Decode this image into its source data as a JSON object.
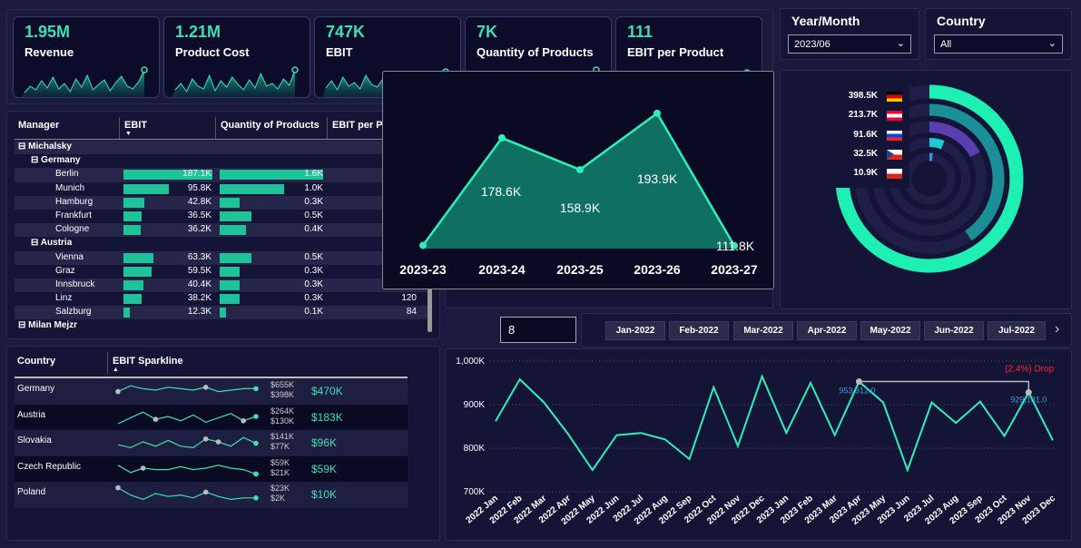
{
  "kpis": [
    {
      "value": "1.95M",
      "label": "Revenue"
    },
    {
      "value": "1.21M",
      "label": "Product Cost"
    },
    {
      "value": "747K",
      "label": "EBIT"
    },
    {
      "value": "7K",
      "label": "Quantity of Products"
    },
    {
      "value": "111",
      "label": "EBIT per Product"
    }
  ],
  "filters": {
    "year_month": {
      "title": "Year/Month",
      "value": "2023/06"
    },
    "country": {
      "title": "Country",
      "value": "All"
    }
  },
  "manager_table": {
    "headers": [
      "Manager",
      "EBIT",
      "Quantity of Products",
      "EBIT per P"
    ],
    "rows": [
      {
        "level": 0,
        "name": "Michalsky",
        "ebit": "",
        "qty": "",
        "epp": ""
      },
      {
        "level": 1,
        "name": "Germany",
        "ebit": "",
        "qty": "",
        "epp": ""
      },
      {
        "level": 2,
        "name": "Berlin",
        "ebit": "187.1K",
        "qty": "1.6K",
        "epp": "",
        "ebit_frac": 1.0,
        "qty_frac": 1.0
      },
      {
        "level": 2,
        "name": "Munich",
        "ebit": "95.8K",
        "qty": "1.0K",
        "epp": "",
        "ebit_frac": 0.51,
        "qty_frac": 0.62
      },
      {
        "level": 2,
        "name": "Hamburg",
        "ebit": "42.8K",
        "qty": "0.3K",
        "epp": "",
        "ebit_frac": 0.23,
        "qty_frac": 0.19
      },
      {
        "level": 2,
        "name": "Frankfurt",
        "ebit": "36.5K",
        "qty": "0.5K",
        "epp": "",
        "ebit_frac": 0.2,
        "qty_frac": 0.31
      },
      {
        "level": 2,
        "name": "Cologne",
        "ebit": "36.2K",
        "qty": "0.4K",
        "epp": "",
        "ebit_frac": 0.19,
        "qty_frac": 0.25
      },
      {
        "level": 1,
        "name": "Austria",
        "ebit": "",
        "qty": "",
        "epp": ""
      },
      {
        "level": 2,
        "name": "Vienna",
        "ebit": "63.3K",
        "qty": "0.5K",
        "epp": "",
        "ebit_frac": 0.34,
        "qty_frac": 0.31
      },
      {
        "level": 2,
        "name": "Graz",
        "ebit": "59.5K",
        "qty": "0.3K",
        "epp": "",
        "ebit_frac": 0.32,
        "qty_frac": 0.19
      },
      {
        "level": 2,
        "name": "Innsbruck",
        "ebit": "40.4K",
        "qty": "0.3K",
        "epp": "",
        "ebit_frac": 0.22,
        "qty_frac": 0.19
      },
      {
        "level": 2,
        "name": "Linz",
        "ebit": "38.2K",
        "qty": "0.3K",
        "epp": "120",
        "ebit_frac": 0.2,
        "qty_frac": 0.19
      },
      {
        "level": 2,
        "name": "Salzburg",
        "ebit": "12.3K",
        "qty": "0.1K",
        "epp": "84",
        "ebit_frac": 0.07,
        "qty_frac": 0.06
      },
      {
        "level": 0,
        "name": "Milan Mejzr",
        "ebit": "",
        "qty": "",
        "epp": ""
      }
    ]
  },
  "country_table": {
    "headers": [
      "Country",
      "EBIT Sparkline"
    ],
    "rows": [
      {
        "country": "Germany",
        "max": "$655K",
        "min": "$398K",
        "total": "$470K"
      },
      {
        "country": "Austria",
        "max": "$264K",
        "min": "$130K",
        "total": "$183K"
      },
      {
        "country": "Slovakia",
        "max": "$141K",
        "min": "$77K",
        "total": "$96K"
      },
      {
        "country": "Czech Republic",
        "max": "$59K",
        "min": "$21K",
        "total": "$59K"
      },
      {
        "country": "Poland",
        "max": "$23K",
        "min": "$2K",
        "total": "$10K"
      }
    ]
  },
  "week_chart": {
    "categories": [
      "2023-23",
      "2023-24",
      "2023-25",
      "2023-26",
      "2023-27"
    ],
    "values": [
      112.0,
      178.6,
      158.9,
      193.9,
      111.8
    ],
    "labels": [
      "",
      "178.6K",
      "158.9K",
      "193.9K",
      "111.8K"
    ]
  },
  "radial": {
    "items": [
      {
        "value": "398.5K",
        "flag": "de"
      },
      {
        "value": "213.7K",
        "flag": "at"
      },
      {
        "value": "91.6K",
        "flag": "sk"
      },
      {
        "value": "32.5K",
        "flag": "cz"
      },
      {
        "value": "10.9K",
        "flag": "pl"
      }
    ],
    "fractions": [
      1.0,
      0.54,
      0.23,
      0.08,
      0.03
    ],
    "colors": [
      "#1ef0b4",
      "#1a8f95",
      "#5a3fb0",
      "#1ec9d8",
      "#3a8fd0"
    ]
  },
  "slider_input": "8",
  "months": [
    "Jan-2022",
    "Feb-2022",
    "Mar-2022",
    "Apr-2022",
    "May-2022",
    "Jun-2022",
    "Jul-2022"
  ],
  "chart_data": {
    "type": "line",
    "x": [
      "2022 Jan",
      "2022 Feb",
      "2022 Mar",
      "2022 Apr",
      "2022 May",
      "2022 Jun",
      "2022 Jul",
      "2022 Aug",
      "2022 Sep",
      "2022 Oct",
      "2022 Nov",
      "2022 Dec",
      "2023 Jan",
      "2023 Feb",
      "2023 Mar",
      "2023 Apr",
      "2023 May",
      "2023 Jun",
      "2023 Jul",
      "2023 Aug",
      "2023 Sep",
      "2023 Oct",
      "2023 Nov",
      "2023 Dec"
    ],
    "values": [
      862,
      958,
      905,
      832,
      750,
      830,
      835,
      820,
      775,
      940,
      805,
      965,
      835,
      950,
      830,
      953,
      905,
      750,
      905,
      858,
      907,
      828,
      928,
      818
    ],
    "ylim": [
      700,
      1000
    ],
    "yticks": [
      "700K",
      "800K",
      "900K",
      "1,000K"
    ],
    "annotation": {
      "label": "(2.4%) Drop",
      "from": "953,312.0",
      "to": "929,131.0"
    }
  }
}
